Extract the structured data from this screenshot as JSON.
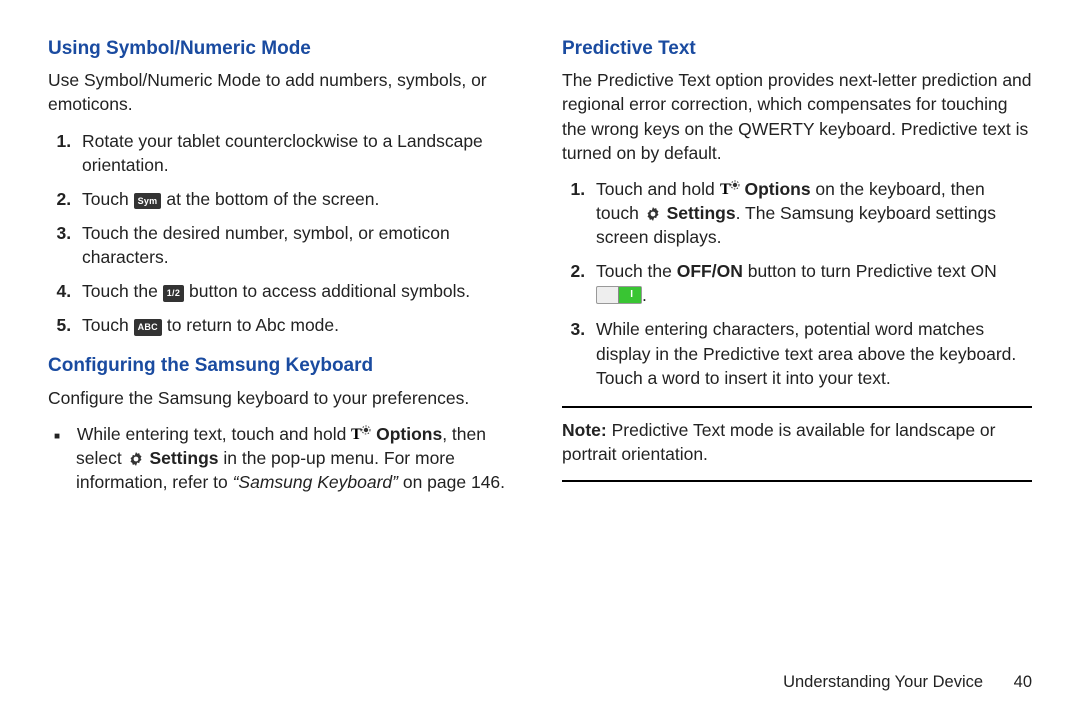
{
  "left": {
    "section1": {
      "heading": "Using Symbol/Numeric Mode",
      "intro": "Use Symbol/Numeric Mode to add numbers, symbols, or emoticons.",
      "steps": {
        "s1": "Rotate your tablet counterclockwise to a Landscape orientation.",
        "s2a": "Touch ",
        "s2_key": "Sym",
        "s2b": " at the bottom of the screen.",
        "s3": "Touch the desired number, symbol, or emoticon characters.",
        "s4a": "Touch the ",
        "s4_key": "1/2",
        "s4b": " button to access additional symbols.",
        "s5a": "Touch ",
        "s5_key": "ABC",
        "s5b": " to return to Abc mode."
      }
    },
    "section2": {
      "heading": "Configuring the Samsung Keyboard",
      "intro": "Configure the Samsung keyboard to your preferences.",
      "bullet": {
        "p1": "While entering text, touch and hold ",
        "options": "Options",
        "p2": ", then select ",
        "settings": "Settings",
        "p3": " in the pop-up menu. For more information, refer to ",
        "ref": "“Samsung Keyboard”",
        "p4": " on page 146."
      }
    }
  },
  "right": {
    "section": {
      "heading": "Predictive Text",
      "intro": "The Predictive Text option provides next-letter prediction and regional error correction, which compensates for touching the wrong keys on the QWERTY keyboard. Predictive text is turned on by default.",
      "steps": {
        "s1a": "Touch and hold ",
        "s1_options": "Options",
        "s1b": " on the keyboard, then touch ",
        "s1_settings": "Settings",
        "s1c": ". The Samsung keyboard settings screen displays.",
        "s2a": "Touch the ",
        "s2_offon": "OFF/ON",
        "s2b": " button to turn Predictive text ON ",
        "s2c": ".",
        "s3": "While entering characters, potential word matches display in the Predictive text area above the keyboard. Touch a word to insert it into your text."
      },
      "note_label": "Note:",
      "note_body": " Predictive Text mode is available for landscape or portrait orientation."
    }
  },
  "footer": {
    "chapter": "Understanding Your Device",
    "page": "40"
  }
}
